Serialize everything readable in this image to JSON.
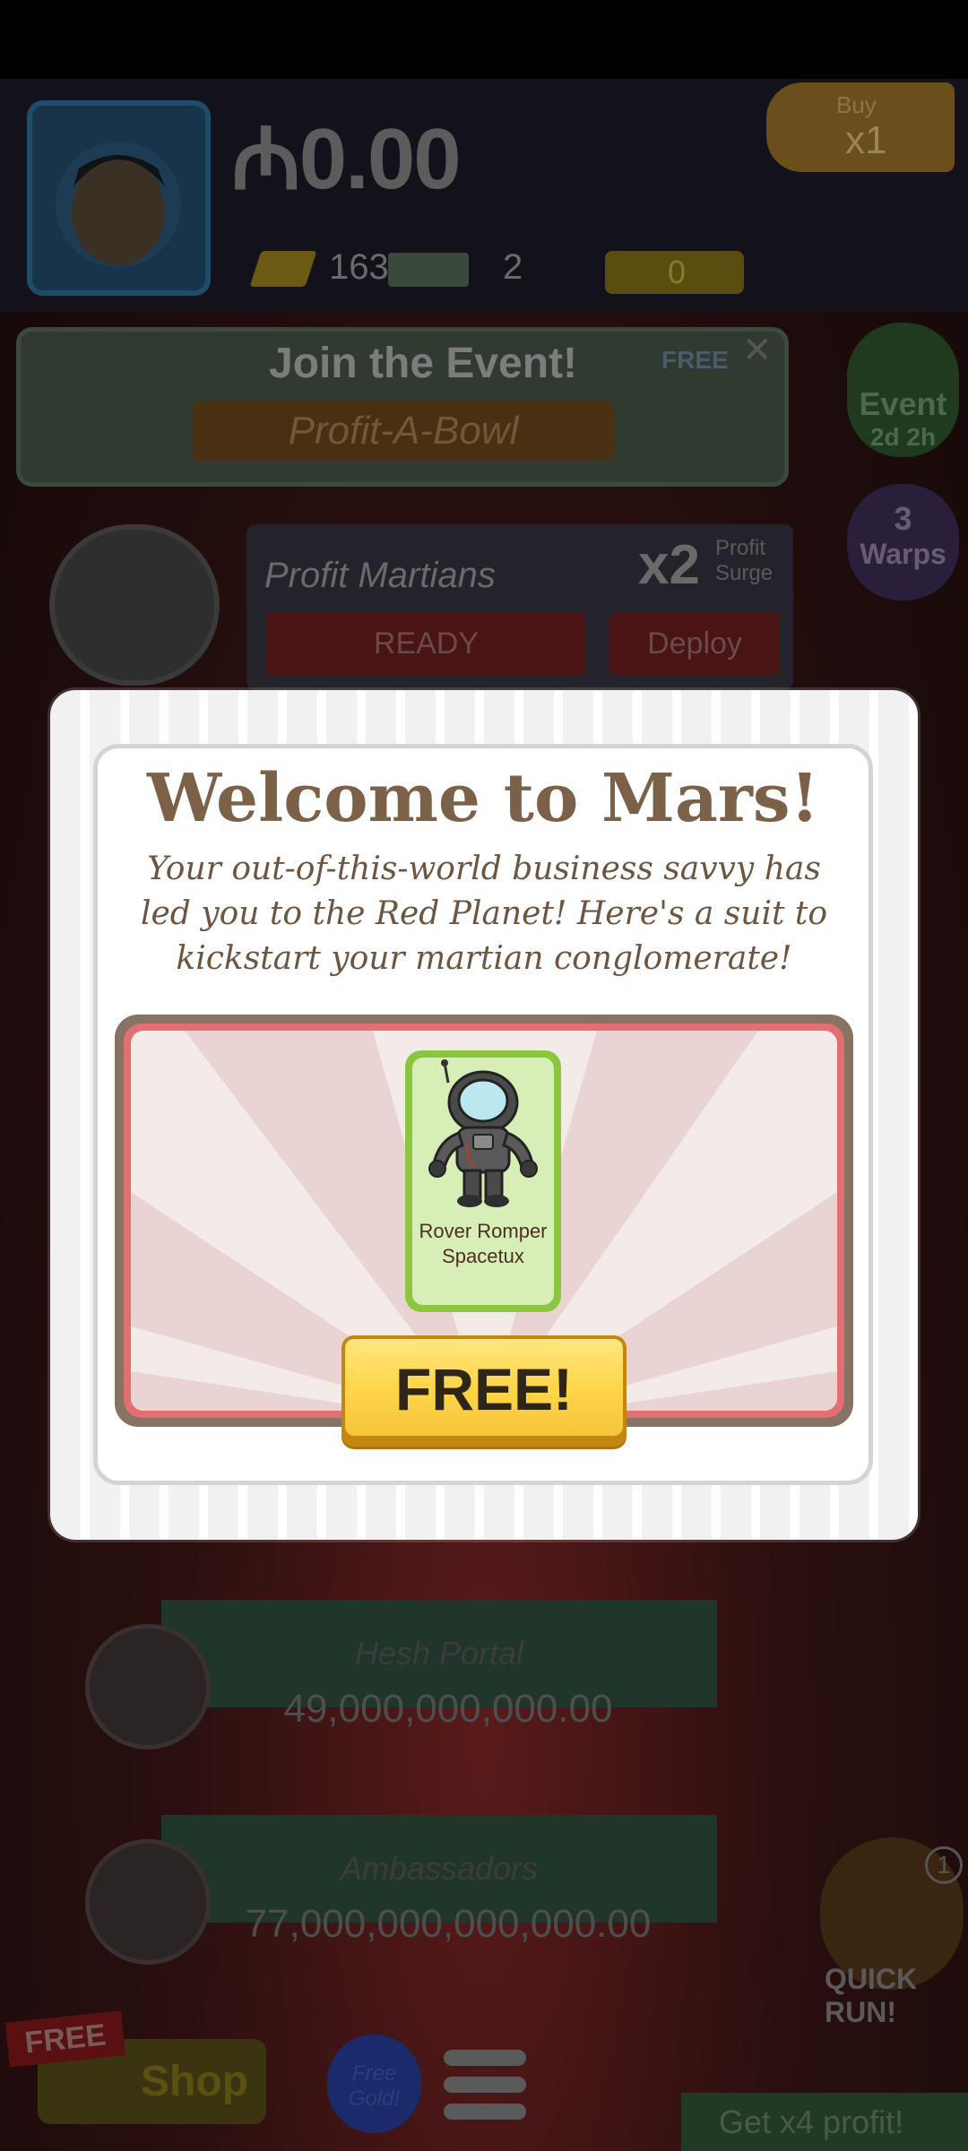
{
  "hud": {
    "cash": "₼0.00",
    "gold_count": "163",
    "ticket_count": "2",
    "megabucks": "0",
    "buy_label": "Buy",
    "buy_multiplier": "x1"
  },
  "event": {
    "title": "Join the Event!",
    "subtitle": "Profit-A-Bowl",
    "free_label": "FREE",
    "close": "✕"
  },
  "side": {
    "event_label": "Event",
    "event_timer": "2d 2h",
    "warps_count": "3",
    "warps_label": "Warps",
    "quick_run_label": "QUICK RUN!",
    "quick_run_badge": "1"
  },
  "profit": {
    "title": "Profit Martians",
    "multiplier": "x2",
    "surge": "Profit Surge",
    "ready": "READY",
    "deploy": "Deploy"
  },
  "businesses": [
    {
      "name": "Hesh Portal",
      "value": "49,000,000,000.00"
    },
    {
      "name": "Ambassadors",
      "value": "77,000,000,000,000.00"
    }
  ],
  "bottom": {
    "free_tag": "FREE",
    "shop": "Shop",
    "free_gold": "Free Gold!",
    "x4_profit": "Get x4 profit!"
  },
  "modal": {
    "title": "Welcome to Mars!",
    "body": "Your out-of-this-world business savvy has led you to the Red Planet! Here's a suit to kickstart your martian conglomerate!",
    "item_name": "Rover Romper Spacetux",
    "button": "FREE!",
    "icon": "astronaut-suit-icon"
  },
  "colors": {
    "title_brown": "#7b6147",
    "button_yellow": "#ffd64a",
    "card_green": "#8cc63f",
    "frame_red": "#e36f72"
  }
}
